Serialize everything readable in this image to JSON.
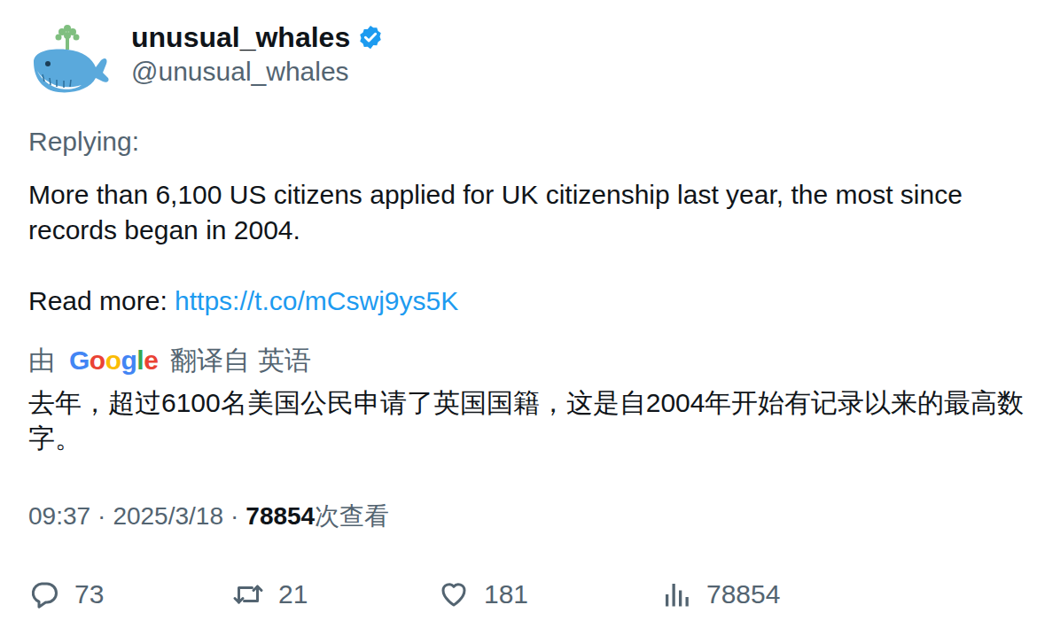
{
  "author": {
    "name": "unusual_whales",
    "handle": "@unusual_whales",
    "verified": true
  },
  "reply_label": "Replying:",
  "text": "More than 6,100 US citizens applied for UK citizenship last year, the most since records began in 2004.",
  "read_more": {
    "label": "Read more: ",
    "url": "https://t.co/mCswj9ys5K"
  },
  "translation": {
    "prefix": "由",
    "provider": "Google",
    "suffix": "翻译自 英语",
    "text": "去年，超过6100名美国公民申请了英国国籍，这是自2004年开始有记录以来的最高数字。"
  },
  "meta": {
    "time": "09:37",
    "separator": "·",
    "date": "2025/3/18",
    "views": "78854",
    "views_label": "次查看"
  },
  "actions": [
    {
      "kind": "reply",
      "count": "73"
    },
    {
      "kind": "retweet",
      "count": "21"
    },
    {
      "kind": "like",
      "count": "181"
    },
    {
      "kind": "views",
      "count": "78854"
    }
  ]
}
